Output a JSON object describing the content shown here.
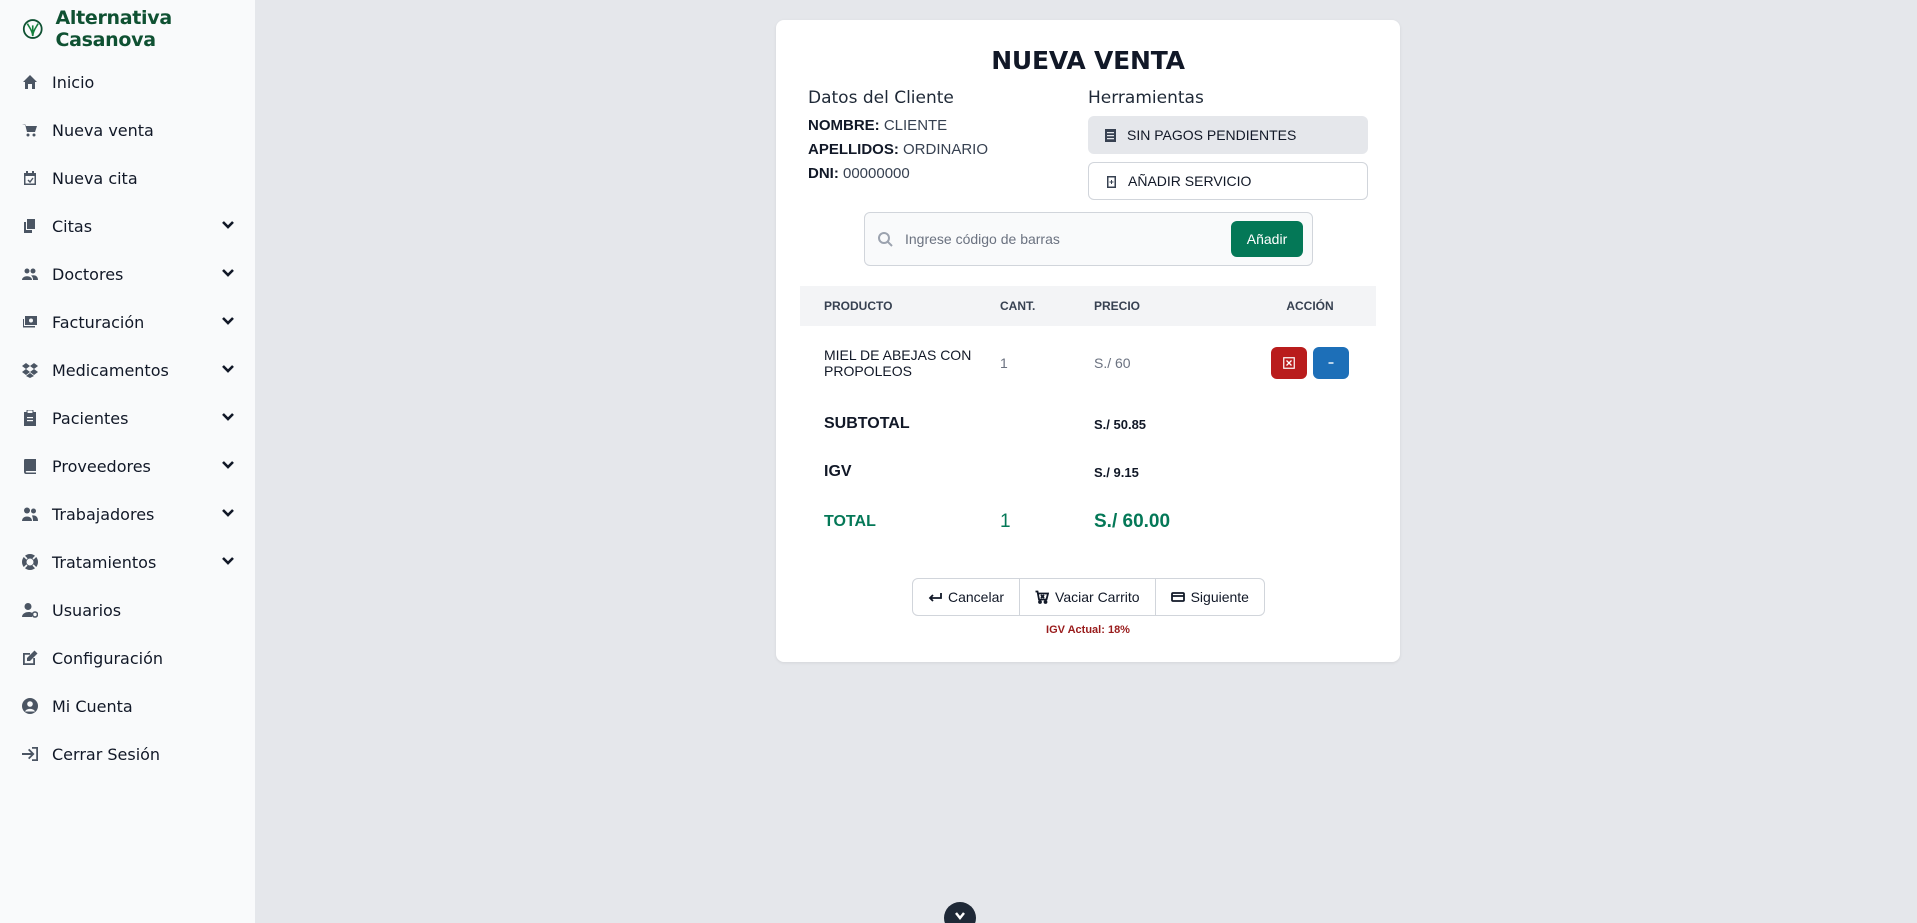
{
  "brand": {
    "name": "Alternativa Casanova",
    "logo_icon": "leaf-logo-icon",
    "color": "#0f5132"
  },
  "sidebar": {
    "items": [
      {
        "label": "Inicio",
        "icon": "home-icon",
        "expandable": false
      },
      {
        "label": "Nueva venta",
        "icon": "cart-icon",
        "expandable": false
      },
      {
        "label": "Nueva cita",
        "icon": "calendar-icon",
        "expandable": false
      },
      {
        "label": "Citas",
        "icon": "copy-icon",
        "expandable": true
      },
      {
        "label": "Doctores",
        "icon": "users-icon",
        "expandable": true
      },
      {
        "label": "Facturación",
        "icon": "money-icon",
        "expandable": true
      },
      {
        "label": "Medicamentos",
        "icon": "dropbox-icon",
        "expandable": true
      },
      {
        "label": "Pacientes",
        "icon": "clipboard-icon",
        "expandable": true
      },
      {
        "label": "Proveedores",
        "icon": "book-icon",
        "expandable": true
      },
      {
        "label": "Trabajadores",
        "icon": "user-group-icon",
        "expandable": true
      },
      {
        "label": "Tratamientos",
        "icon": "lifebuoy-icon",
        "expandable": true
      },
      {
        "label": "Usuarios",
        "icon": "user-cog-icon",
        "expandable": false
      },
      {
        "label": "Configuración",
        "icon": "edit-icon",
        "expandable": false
      },
      {
        "label": "Mi Cuenta",
        "icon": "user-circle-icon",
        "expandable": false
      },
      {
        "label": "Cerrar Sesión",
        "icon": "logout-icon",
        "expandable": false
      }
    ]
  },
  "sale": {
    "title": "NUEVA VENTA",
    "client": {
      "heading": "Datos del Cliente",
      "name_label": "NOMBRE:",
      "name_value": "CLIENTE",
      "surname_label": "APELLIDOS:",
      "surname_value": "ORDINARIO",
      "dni_label": "DNI:",
      "dni_value": "00000000"
    },
    "tools": {
      "heading": "Herramientas",
      "pending_label": "SIN PAGOS PENDIENTES",
      "add_service_label": "AÑADIR SERVICIO"
    },
    "search": {
      "placeholder": "Ingrese código de barras",
      "add_label": "Añadir"
    },
    "table": {
      "headers": {
        "product": "PRODUCTO",
        "qty": "CANT.",
        "price": "PRECIO",
        "action": "ACCIÓN"
      },
      "rows": [
        {
          "product": "MIEL DE ABEJAS CON PROPOLEOS",
          "qty": "1",
          "price": "S./ 60"
        }
      ],
      "subtotal_label": "SUBTOTAL",
      "subtotal_value": "S./ 50.85",
      "igv_label": "IGV",
      "igv_value": "S./ 9.15",
      "total_label": "TOTAL",
      "total_qty": "1",
      "total_value": "S./ 60.00"
    },
    "footer": {
      "cancel_label": "Cancelar",
      "empty_cart_label": "Vaciar Carrito",
      "next_label": "Siguiente",
      "igv_note": "IGV Actual: 18%"
    }
  },
  "colors": {
    "accent_green": "#047857",
    "danger_red": "#b91c1c",
    "info_blue": "#1d6fb8"
  }
}
